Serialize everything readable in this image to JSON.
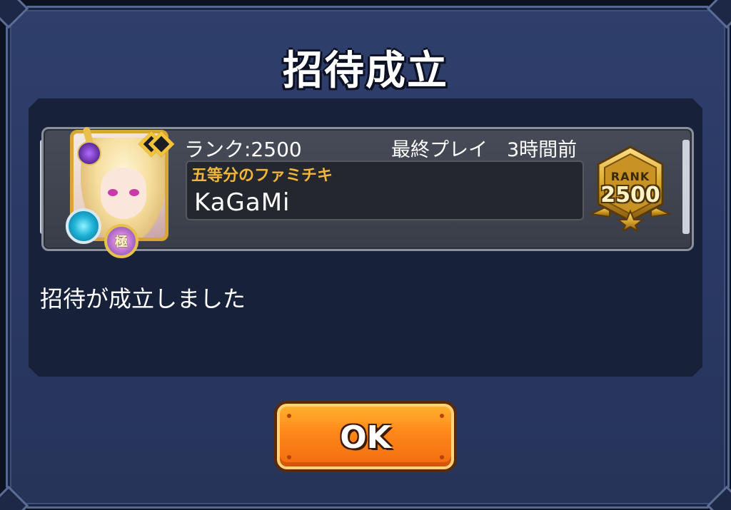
{
  "dialog": {
    "title": "招待成立",
    "message": "招待が成立しました"
  },
  "player": {
    "rank_line": "ランク:2500",
    "last_play": "最終プレイ　3時間前",
    "title": "五等分のファミチキ",
    "name": "KaGaMi",
    "medal_label": "極",
    "rank_badge": {
      "label": "RANK",
      "value": "2500"
    }
  },
  "buttons": {
    "ok_label": "OK"
  },
  "colors": {
    "dialog_bg": "#2f3f6b",
    "panel_bg": "#18213a",
    "title_gold": "#f2b63a",
    "button_orange": "#ff8a1a"
  }
}
